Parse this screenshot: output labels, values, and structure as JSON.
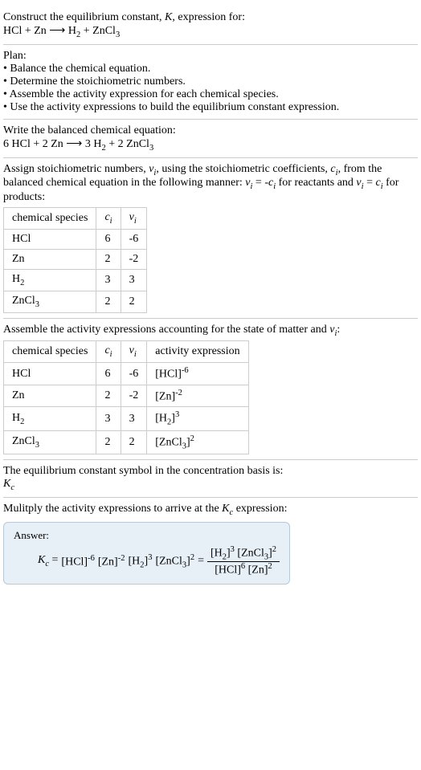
{
  "prompt": {
    "line1": "Construct the equilibrium constant, K, expression for:",
    "equation_unbalanced": "HCl + Zn ⟶ H₂ + ZnCl₃"
  },
  "plan": {
    "header": "Plan:",
    "items": [
      "• Balance the chemical equation.",
      "• Determine the stoichiometric numbers.",
      "• Assemble the activity expression for each chemical species.",
      "• Use the activity expressions to build the equilibrium constant expression."
    ]
  },
  "balanced": {
    "header": "Write the balanced chemical equation:",
    "equation": "6 HCl + 2 Zn ⟶ 3 H₂ + 2 ZnCl₃"
  },
  "stoich": {
    "intro": "Assign stoichiometric numbers, νᵢ, using the stoichiometric coefficients, cᵢ, from the balanced chemical equation in the following manner: νᵢ = -cᵢ for reactants and νᵢ = cᵢ for products:",
    "headers": [
      "chemical species",
      "cᵢ",
      "νᵢ"
    ],
    "rows": [
      [
        "HCl",
        "6",
        "-6"
      ],
      [
        "Zn",
        "2",
        "-2"
      ],
      [
        "H₂",
        "3",
        "3"
      ],
      [
        "ZnCl₃",
        "2",
        "2"
      ]
    ]
  },
  "activity": {
    "intro": "Assemble the activity expressions accounting for the state of matter and νᵢ:",
    "headers": [
      "chemical species",
      "cᵢ",
      "νᵢ",
      "activity expression"
    ],
    "rows": [
      {
        "species": "HCl",
        "c": "6",
        "v": "-6",
        "expr_base": "[HCl]",
        "expr_exp": "-6"
      },
      {
        "species": "Zn",
        "c": "2",
        "v": "-2",
        "expr_base": "[Zn]",
        "expr_exp": "-2"
      },
      {
        "species": "H₂",
        "c": "3",
        "v": "3",
        "expr_base": "[H₂]",
        "expr_exp": "3"
      },
      {
        "species": "ZnCl₃",
        "c": "2",
        "v": "2",
        "expr_base": "[ZnCl₃]",
        "expr_exp": "2"
      }
    ]
  },
  "basis": {
    "line1": "The equilibrium constant symbol in the concentration basis is:",
    "symbol": "K꜀"
  },
  "multiply": {
    "intro": "Mulitply the activity expressions to arrive at the K꜀ expression:"
  },
  "answer": {
    "label": "Answer:",
    "lhs": "K꜀ = ",
    "terms": [
      {
        "base": "[HCl]",
        "exp": "-6"
      },
      {
        "base": "[Zn]",
        "exp": "-2"
      },
      {
        "base": "[H₂]",
        "exp": "3"
      },
      {
        "base": "[ZnCl₃]",
        "exp": "2"
      }
    ],
    "eq": " = ",
    "frac_num": [
      {
        "base": "[H₂]",
        "exp": "3"
      },
      {
        "base": "[ZnCl₃]",
        "exp": "2"
      }
    ],
    "frac_den": [
      {
        "base": "[HCl]",
        "exp": "6"
      },
      {
        "base": "[Zn]",
        "exp": "2"
      }
    ]
  }
}
